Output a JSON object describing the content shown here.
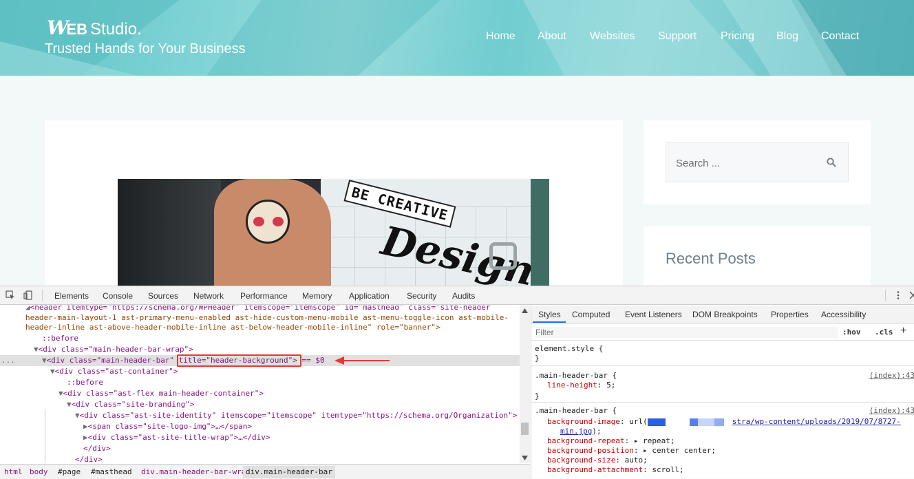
{
  "site": {
    "logo": {
      "w": "W",
      "eb": "EB",
      "studio": "Studio."
    },
    "tagline": "Trusted Hands for Your Business",
    "nav": [
      "Home",
      "About",
      "Websites",
      "Support",
      "Pricing",
      "Blog",
      "Contact"
    ],
    "hero": {
      "banner_text": "BE CREATIVE",
      "script_text": "Design"
    },
    "search": {
      "placeholder": "Search ..."
    },
    "sidebar_heading": "Recent Posts"
  },
  "devtools": {
    "tabs": [
      "Elements",
      "Console",
      "Sources",
      "Network",
      "Performance",
      "Memory",
      "Application",
      "Security",
      "Audits"
    ],
    "elements_lines": [
      "<header itemtype=\"https://schema.org/WPHeader\" itemscope=\"itemscope\" id=\"masthead\" class=\"site-header",
      "header-main-layout-1 ast-primary-menu-enabled ast-hide-custom-menu-mobile ast-menu-toggle-icon ast-mobile-",
      "header-inline ast-above-header-mobile-inline ast-below-header-mobile-inline\" role=\"banner\">",
      "::before",
      "<div class=\"main-header-bar-wrap\">",
      "<div class=\"main-header-bar\" title=\"header-background\"> == $0",
      "<div class=\"ast-container\">",
      "::before",
      "<div class=\"ast-flex main-header-container\">",
      "<div class=\"site-branding\">",
      "<div class=\"ast-site-identity\" itemscope=\"itemscope\" itemtype=\"https://schema.org/Organization\">",
      "<span class=\"site-logo-img\">…</span>",
      "<div class=\"ast-site-title-wrap\">…</div>",
      "</div>",
      "</div>"
    ],
    "selected_marker": "...",
    "breadcrumb": [
      "html",
      "body",
      "#page",
      "#masthead",
      "div.main-header-bar-wrap",
      "div.main-header-bar"
    ],
    "styles_tabs": [
      "Styles",
      "Computed",
      "Event Listeners",
      "DOM Breakpoints",
      "Properties",
      "Accessibility"
    ],
    "filter_placeholder": "Filter",
    "hov": ":hov",
    "cls": ".cls",
    "plus": "+",
    "rules": {
      "element_style": "element.style {",
      "close": "}",
      "rule1_selector": ".main-header-bar {",
      "rule1_source": "(index):43",
      "rule1_prop": "line-height",
      "rule1_value": ": 5;",
      "rule2_selector": ".main-header-bar {",
      "rule2_source": "(index):43",
      "bg_image_prop": "background-image",
      "bg_image_prefix": ": url(",
      "bg_image_url": "stra/wp-content/uploads/2019/07/8727-",
      "bg_image_url2": "min.jpg",
      "bg_image_suffix": ");",
      "bg_repeat_prop": "background-repeat",
      "bg_repeat_value": "repeat;",
      "bg_position_prop": "background-position",
      "bg_position_value": "center center;",
      "bg_size_prop": "background-size",
      "bg_size_value": ": auto;",
      "bg_attach_prop": "background-attachment",
      "bg_attach_value": ": scroll;"
    }
  },
  "colors": {
    "header_teal": "#6fcfd2",
    "highlight_red": "#e53935",
    "tag": "#881280",
    "attr_name": "#994500",
    "attr_value": "#1a1aa6"
  }
}
